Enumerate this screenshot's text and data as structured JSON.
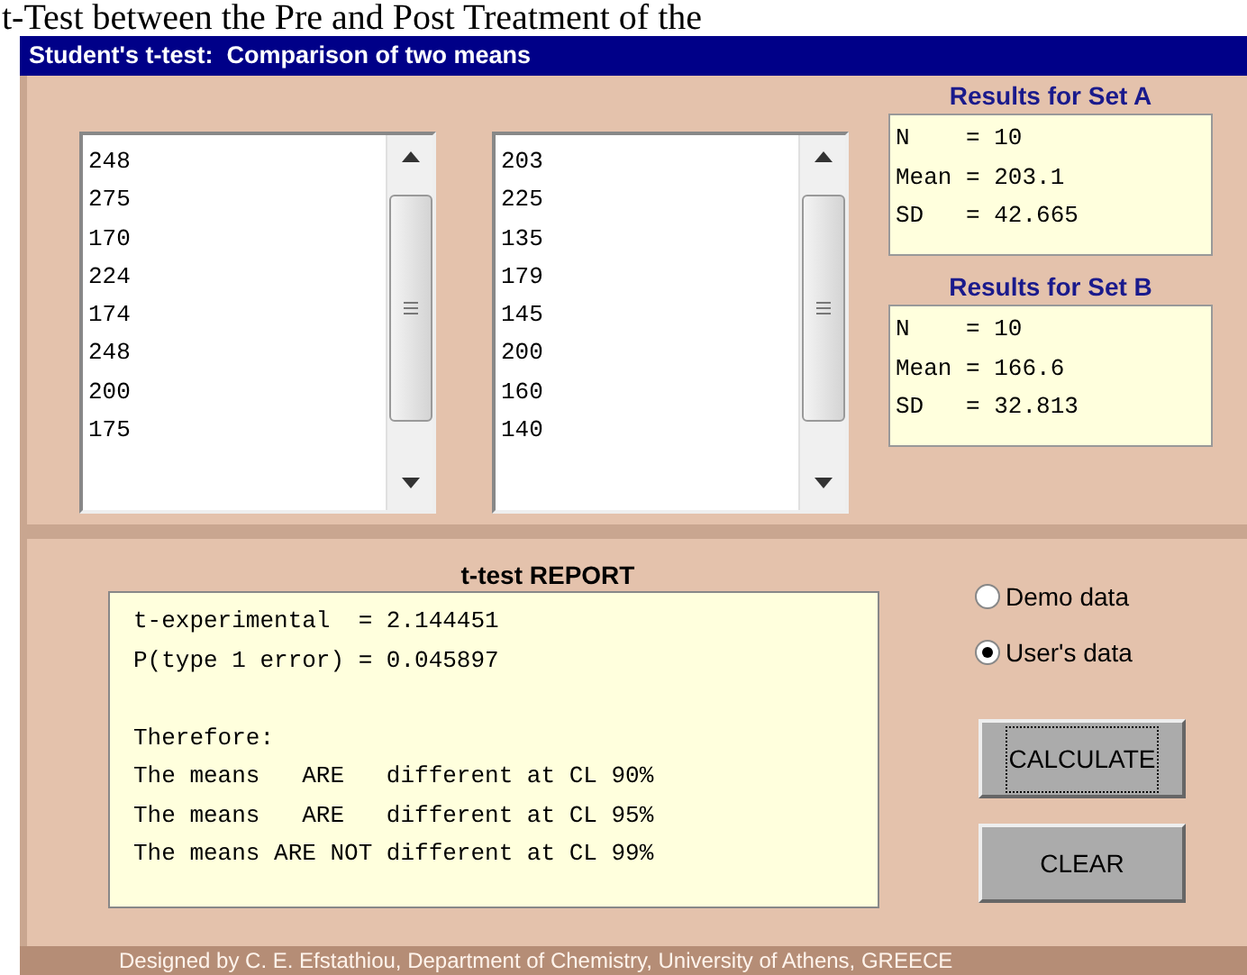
{
  "heading": "t-Test between the Pre and Post Treatment of the",
  "window": {
    "title": "Student's t-test:  Comparison of two means"
  },
  "data_sets": [
    {
      "values": [
        "248",
        "275",
        "170",
        "224",
        "174",
        "248",
        "200",
        "175"
      ]
    },
    {
      "values": [
        "203",
        "225",
        "135",
        "179",
        "145",
        "200",
        "160",
        "140"
      ]
    }
  ],
  "results": [
    {
      "title": "Results for Set A",
      "lines": [
        "N    = 10",
        "Mean = 203.1",
        "SD   = 42.665"
      ]
    },
    {
      "title": "Results for Set B",
      "lines": [
        "N    = 10",
        "Mean = 166.6",
        "SD   = 32.813"
      ]
    }
  ],
  "report": {
    "title": "t-test REPORT",
    "blocks": [
      [
        "t-experimental  = 2.144451",
        "P(type 1 error) = 0.045897"
      ],
      [
        "Therefore:",
        "The means   ARE   different at CL 90%",
        "The means   ARE   different at CL 95%",
        "The means ARE NOT different at CL 99%"
      ]
    ]
  },
  "options": [
    {
      "label": "Demo data",
      "selected": false
    },
    {
      "label": "User's data",
      "selected": true
    }
  ],
  "buttons": [
    {
      "label": "CALCULATE",
      "focused": true
    },
    {
      "label": "CLEAR",
      "focused": false
    }
  ],
  "footer": "Designed by C. E. Efstathiou, Department of Chemistry, University of Athens, GREECE"
}
